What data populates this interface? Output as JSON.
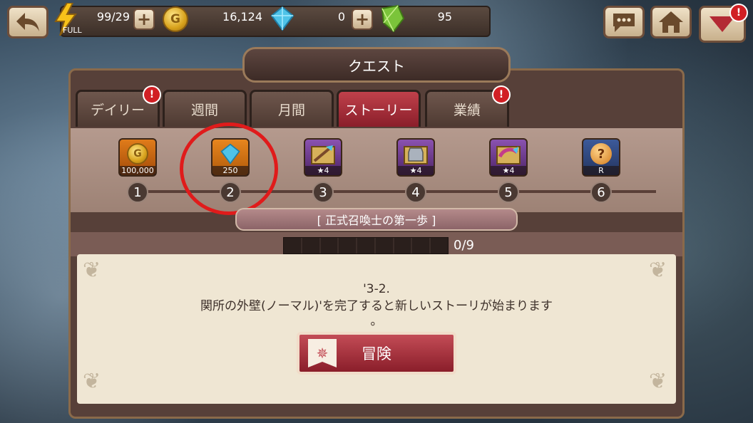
{
  "topbar": {
    "stamina": {
      "value": "99/29",
      "status": "FULL"
    },
    "gold": {
      "symbol": "G",
      "value": "16,124"
    },
    "crystal": {
      "value": "0"
    },
    "gem": {
      "value": "95"
    },
    "plus": "+"
  },
  "quest": {
    "title": "クエスト",
    "tabs": [
      "デイリー",
      "週間",
      "月間",
      "ストーリー",
      "業績"
    ],
    "alert": "!",
    "rewards": [
      {
        "step": "1",
        "qty": "100,000"
      },
      {
        "step": "2",
        "qty": "250"
      },
      {
        "step": "3",
        "qty": "4"
      },
      {
        "step": "4",
        "qty": "4"
      },
      {
        "step": "5",
        "qty": "4"
      },
      {
        "step": "6",
        "qty": "R"
      }
    ],
    "chapter": "[ 正式召喚士の第一歩 ]",
    "progress": {
      "text": "0/9",
      "current": 0,
      "total": 9
    },
    "description": [
      "'3-2.",
      "関所の外壁(ノーマル)'を完了すると新しいストーリが始まります",
      "。"
    ],
    "adventure_button": "冒険"
  },
  "colors": {
    "accent_red": "#c0414b",
    "highlight": "#e01b1b"
  }
}
